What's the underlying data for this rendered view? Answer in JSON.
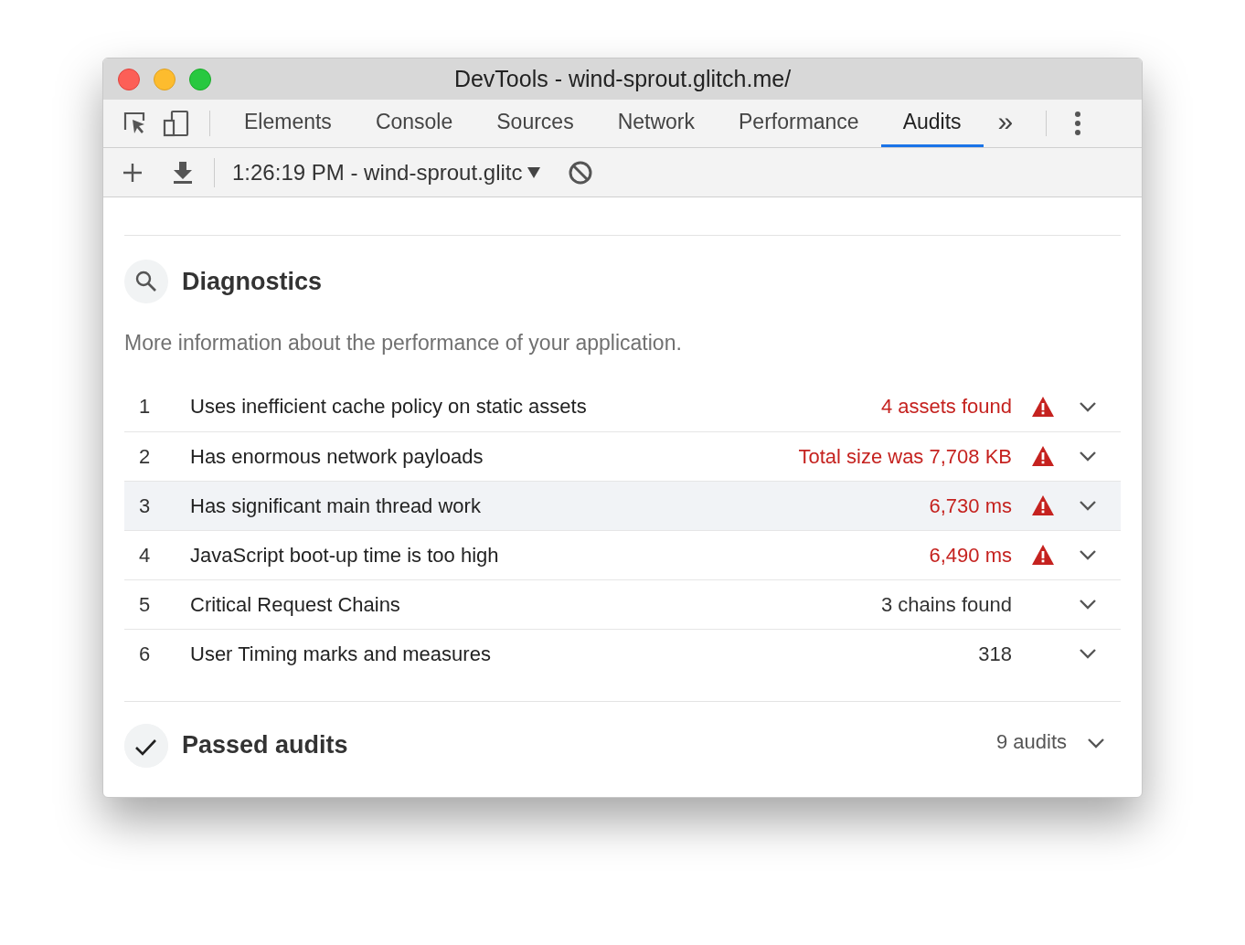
{
  "window": {
    "title": "DevTools - wind-sprout.glitch.me/"
  },
  "tabs": [
    {
      "label": "Elements",
      "selected": false
    },
    {
      "label": "Console",
      "selected": false
    },
    {
      "label": "Sources",
      "selected": false
    },
    {
      "label": "Network",
      "selected": false
    },
    {
      "label": "Performance",
      "selected": false
    },
    {
      "label": "Audits",
      "selected": true
    }
  ],
  "more_tabs": "»",
  "report_selector": {
    "value": "1:26:19 PM - wind-sprout.glitc"
  },
  "diagnostics": {
    "title": "Diagnostics",
    "description": "More information about the performance of your application.",
    "rows": [
      {
        "number": "1",
        "title": "Uses inefficient cache policy on static assets",
        "value": "4 assets found",
        "kind": "fail",
        "highlighted": false
      },
      {
        "number": "2",
        "title": "Has enormous network payloads",
        "value": "Total size was 7,708 KB",
        "kind": "fail",
        "highlighted": false
      },
      {
        "number": "3",
        "title": "Has significant main thread work",
        "value": "6,730 ms",
        "kind": "fail",
        "highlighted": true
      },
      {
        "number": "4",
        "title": "JavaScript boot-up time is too high",
        "value": "6,490 ms",
        "kind": "fail",
        "highlighted": false
      },
      {
        "number": "5",
        "title": "Critical Request Chains",
        "value": "3 chains found",
        "kind": "info",
        "highlighted": false
      },
      {
        "number": "6",
        "title": "User Timing marks and measures",
        "value": "318",
        "kind": "info",
        "highlighted": false
      }
    ]
  },
  "passed": {
    "title": "Passed audits",
    "count": "9 audits"
  }
}
